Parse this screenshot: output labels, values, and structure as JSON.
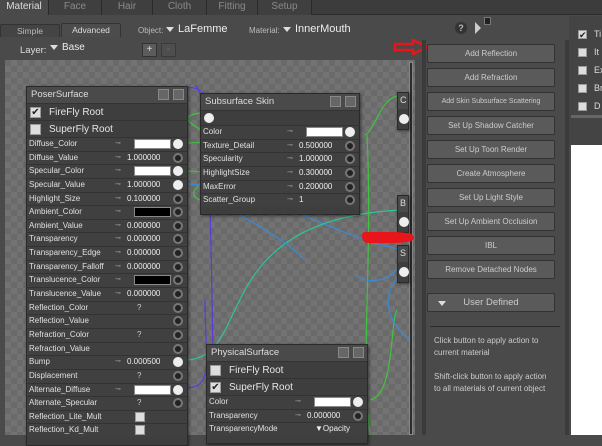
{
  "tabs": [
    {
      "label": "Material",
      "active": true
    },
    {
      "label": "Face"
    },
    {
      "label": "Hair"
    },
    {
      "label": "Cloth"
    },
    {
      "label": "Fitting"
    },
    {
      "label": "Setup"
    }
  ],
  "subtabs": [
    {
      "label": "Simple"
    },
    {
      "label": "Advanced",
      "active": true
    }
  ],
  "object": {
    "label": "Object:",
    "value": "LaFemme"
  },
  "material": {
    "label": "Material:",
    "value": "InnerMouth"
  },
  "layer": {
    "label": "Layer:",
    "value": "Base"
  },
  "layer_add": "+",
  "layer_remove": "-",
  "poser_surface": {
    "title": "PoserSurface",
    "roots": [
      {
        "label": "FireFly Root",
        "checked": true
      },
      {
        "label": "SuperFly Root",
        "checked": false
      }
    ],
    "params": [
      {
        "label": "Diffuse_Color",
        "type": "color",
        "color": "#ffffff",
        "connected": true
      },
      {
        "label": "Diffuse_Value",
        "type": "num",
        "value": "1.000000"
      },
      {
        "label": "Specular_Color",
        "type": "color",
        "color": "#ffffff",
        "connected": true
      },
      {
        "label": "Specular_Value",
        "type": "num",
        "value": "1.000000",
        "connected": true
      },
      {
        "label": "Highlight_Size",
        "type": "num",
        "value": "0.100000"
      },
      {
        "label": "Ambient_Color",
        "type": "color",
        "color": "#000000"
      },
      {
        "label": "Ambient_Value",
        "type": "num",
        "value": "0.000000"
      },
      {
        "label": "Transparency",
        "type": "num",
        "value": "0.000000"
      },
      {
        "label": "Transparency_Edge",
        "type": "num",
        "value": "0.000000"
      },
      {
        "label": "Transparency_Falloff",
        "type": "num",
        "value": "0.000000"
      },
      {
        "label": "Translucence_Color",
        "type": "color",
        "color": "#000000"
      },
      {
        "label": "Translucence_Value",
        "type": "num",
        "value": "0.000000"
      },
      {
        "label": "Reflection_Color",
        "type": "q",
        "value": "?"
      },
      {
        "label": "Reflection_Value",
        "type": "none"
      },
      {
        "label": "Refraction_Color",
        "type": "q",
        "value": "?"
      },
      {
        "label": "Refraction_Value",
        "type": "none"
      },
      {
        "label": "Bump",
        "type": "num",
        "value": "0.000500",
        "connected": true
      },
      {
        "label": "Displacement",
        "type": "q",
        "value": "?"
      },
      {
        "label": "Alternate_Diffuse",
        "type": "color",
        "color": "#ffffff",
        "connected": true
      },
      {
        "label": "Alternate_Specular",
        "type": "q",
        "value": "?"
      },
      {
        "label": "Reflection_Lite_Mult",
        "type": "check"
      },
      {
        "label": "Reflection_Kd_Mult",
        "type": "check"
      }
    ]
  },
  "subsurface": {
    "title": "Subsurface Skin",
    "params": [
      {
        "label": "Color",
        "type": "color",
        "color": "#ffffff",
        "connected": true
      },
      {
        "label": "Texture_Detail",
        "type": "num",
        "value": "0.500000"
      },
      {
        "label": "Specularity",
        "type": "num",
        "value": "1.000000"
      },
      {
        "label": "HighlightSize",
        "type": "num",
        "value": "0.300000"
      },
      {
        "label": "MaxError",
        "type": "num",
        "value": "0.200000"
      },
      {
        "label": "Scatter_Group",
        "type": "num",
        "value": "1"
      }
    ]
  },
  "physical": {
    "title": "PhysicalSurface",
    "roots": [
      {
        "label": "FireFly Root",
        "checked": false
      },
      {
        "label": "SuperFly Root",
        "checked": true
      }
    ],
    "params": [
      {
        "label": "Color",
        "type": "color",
        "color": "#ffffff",
        "connected": true
      },
      {
        "label": "Transparency",
        "type": "num",
        "value": "0.000000"
      },
      {
        "label": "TransparencyMode",
        "type": "dropdown",
        "value": "Opacity"
      }
    ]
  },
  "edge_nodes": [
    "C",
    "B",
    "S"
  ],
  "buttons": [
    "Add Reflection",
    "Add Refraction",
    "Add Skin Subsurface Scattering",
    "Set Up Shadow Catcher",
    "Set Up Toon Render",
    "Create Atmosphere",
    "Set Up Light Style",
    "Set Up Ambient Occlusion",
    "IBL",
    "Remove Detached Nodes"
  ],
  "user_defined": "User Defined",
  "help1": "Click button to apply action to current material",
  "help2": "Shift-click button to apply action to all materials of current object",
  "help_icon": "?",
  "right_panel": [
    {
      "label": "Ti",
      "checked": true
    },
    {
      "label": "It",
      "checked": false
    },
    {
      "label": "Ex",
      "checked": false
    },
    {
      "label": "Br",
      "checked": false
    },
    {
      "label": "D",
      "checked": false
    }
  ],
  "colors": {
    "wire_green": "#3fc43f",
    "wire_teal": "#2fc49a",
    "wire_blue": "#3a8ad8",
    "wire_purple": "#5a3ad8",
    "annotation_red": "#e8151a"
  }
}
